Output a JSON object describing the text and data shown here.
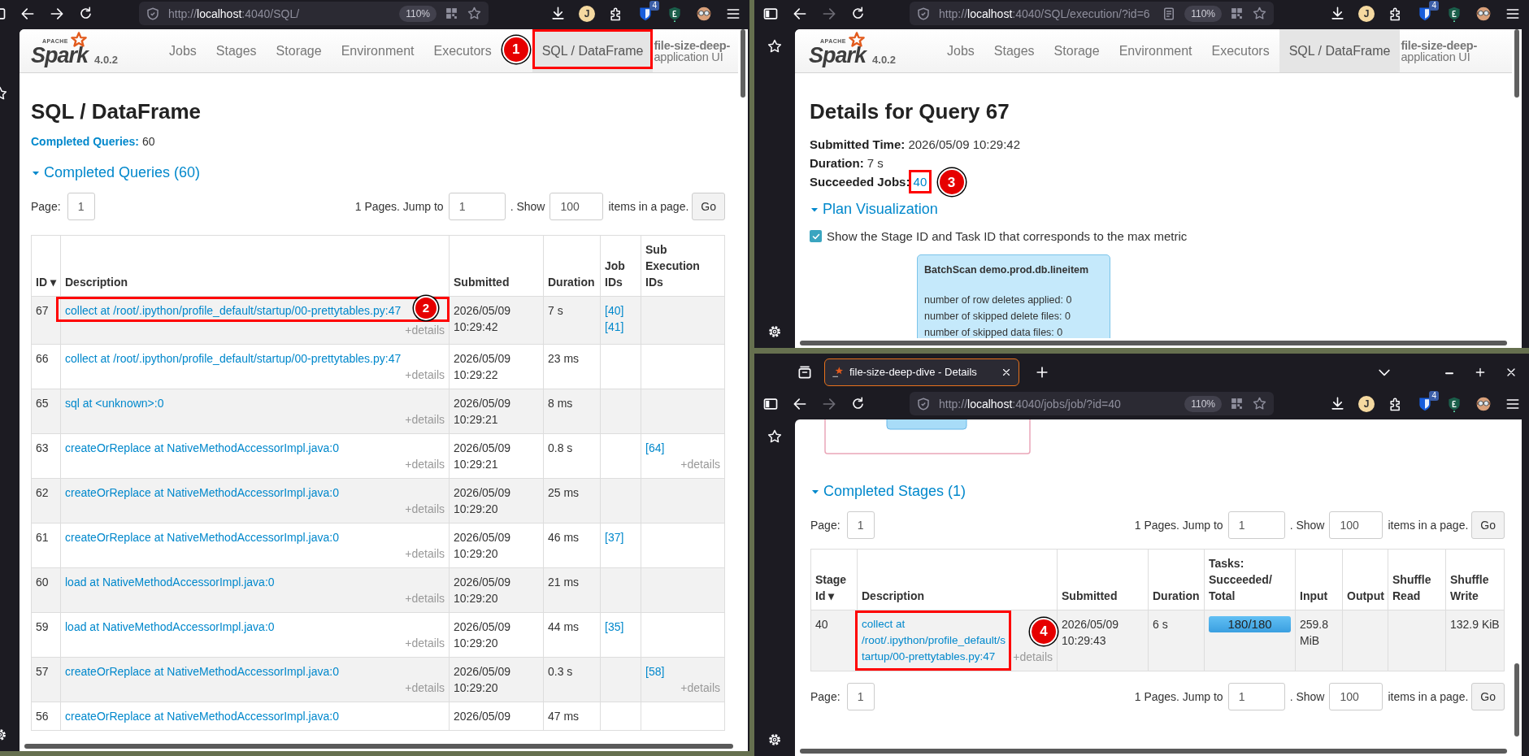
{
  "left_window": {
    "toolbar": {
      "url": {
        "scheme": "http://",
        "host": "localhost",
        "path": ":4040/SQL/"
      },
      "zoom": "110%",
      "profile_initial": "J",
      "extension_badge": "4",
      "forward_disabled": false
    },
    "navbar": {
      "logo_caption": "APACHE",
      "logo_word": "Spark",
      "version": "4.0.2",
      "tabs": [
        {
          "label": "Jobs",
          "selected": false
        },
        {
          "label": "Stages",
          "selected": false
        },
        {
          "label": "Storage",
          "selected": false
        },
        {
          "label": "Environment",
          "selected": false
        },
        {
          "label": "Executors",
          "selected": false
        },
        {
          "label": "SQL / DataFrame",
          "selected": true,
          "annotation": "1"
        }
      ],
      "app_name": [
        "file-size-deep-",
        "application UI"
      ]
    },
    "title": "SQL / DataFrame",
    "summary": "**Completed Queries:** 60",
    "section": {
      "title": "Completed Queries (60)",
      "expanded": true
    },
    "pager": {
      "page_label": "Page:",
      "page": "1",
      "pages_text": "1 Pages. Jump to",
      "jump": "1",
      "show_text": ". Show",
      "page_size": "100",
      "items_text": "items in a page.",
      "button": "Go"
    },
    "table": {
      "columns": [
        "ID ▾",
        "Description",
        "Submitted",
        "Duration",
        "Job IDs",
        "Sub Execution IDs"
      ],
      "rows": [
        {
          "id": "67",
          "description": "collect at /root/.ipython/profile_default/startup/00-prettytables.py:47",
          "details": "+details",
          "submitted": "2026/05/09 10:29:42",
          "duration": "7 s",
          "job_ids": [
            "[40]",
            "[41]"
          ],
          "annotation": "2"
        },
        {
          "id": "66",
          "description": "collect at /root/.ipython/profile_default/startup/00-prettytables.py:47",
          "details": "+details",
          "submitted": "2026/05/09 10:29:22",
          "duration": "23 ms"
        },
        {
          "id": "65",
          "description": "sql at <unknown>:0",
          "details": "+details",
          "submitted": "2026/05/09 10:29:21",
          "duration": "8 ms"
        },
        {
          "id": "63",
          "description": "createOrReplace at NativeMethodAccessorImpl.java:0",
          "details": "+details",
          "submitted": "2026/05/09 10:29:21",
          "duration": "0.8 s",
          "sub_ids": [
            "[64]"
          ],
          "sub_details": "+details"
        },
        {
          "id": "62",
          "description": "createOrReplace at NativeMethodAccessorImpl.java:0",
          "details": "+details",
          "submitted": "2026/05/09 10:29:20",
          "duration": "25 ms"
        },
        {
          "id": "61",
          "description": "createOrReplace at NativeMethodAccessorImpl.java:0",
          "details": "+details",
          "submitted": "2026/05/09 10:29:20",
          "duration": "46 ms",
          "job_ids": [
            "[37]"
          ]
        },
        {
          "id": "60",
          "description": "load at NativeMethodAccessorImpl.java:0",
          "details": "+details",
          "submitted": "2026/05/09 10:29:20",
          "duration": "21 ms"
        },
        {
          "id": "59",
          "description": "load at NativeMethodAccessorImpl.java:0",
          "details": "+details",
          "submitted": "2026/05/09 10:29:20",
          "duration": "44 ms",
          "job_ids": [
            "[35]"
          ]
        },
        {
          "id": "57",
          "description": "createOrReplace at NativeMethodAccessorImpl.java:0",
          "details": "+details",
          "submitted": "2026/05/09 10:29:20",
          "duration": "0.3 s",
          "sub_ids": [
            "[58]"
          ],
          "sub_details": "+details"
        },
        {
          "id": "56",
          "description": "createOrReplace at NativeMethodAccessorImpl.java:0",
          "submitted": "2026/05/09",
          "duration": "47 ms"
        }
      ]
    }
  },
  "top_right_window": {
    "toolbar": {
      "url": {
        "scheme": "http://",
        "host": "localhost",
        "path": ":4040/SQL/execution/?id=6"
      },
      "reader_mode_available": true,
      "zoom": "110%",
      "profile_initial": "J",
      "extension_badge": "4",
      "forward_disabled": true
    },
    "navbar": {
      "logo_caption": "APACHE",
      "logo_word": "Spark",
      "version": "4.0.2",
      "tabs": [
        {
          "label": "Jobs",
          "selected": false
        },
        {
          "label": "Stages",
          "selected": false
        },
        {
          "label": "Storage",
          "selected": false
        },
        {
          "label": "Environment",
          "selected": false
        },
        {
          "label": "Executors",
          "selected": false
        },
        {
          "label": "SQL / DataFrame",
          "selected": true
        }
      ],
      "app_name": [
        "file-size-deep-",
        "application UI"
      ]
    },
    "title": "Details for Query 67",
    "details": [
      {
        "text": "**Submitted Time:** 2026/05/09 10:29:42"
      },
      {
        "text": "**Duration:** 7 s"
      },
      {
        "text": "**Succeeded Jobs:**",
        "link": "40",
        "annotation": "3"
      }
    ],
    "plan": {
      "title": "Plan Visualization",
      "expanded": true
    },
    "max_metric": {
      "label": "Show the Stage ID and Task ID that corresponds to the max metric",
      "checked": true
    },
    "plan_node": {
      "title": "BatchScan demo.prod.db.lineitem",
      "metrics": [
        "number of row deletes applied: 0",
        "number of skipped delete files: 0",
        "number of skipped data files: 0"
      ]
    }
  },
  "bottom_right_window": {
    "tab": {
      "title": "file-size-deep-dive - Details"
    },
    "toolbar": {
      "url": {
        "scheme": "http://",
        "host": "localhost",
        "path": ":4040/jobs/job/?id=40"
      },
      "zoom": "110%",
      "profile_initial": "J",
      "extension_badge": "4",
      "forward_disabled": true
    },
    "section": {
      "title": "Completed Stages (1)",
      "expanded": true
    },
    "pager": {
      "page_label": "Page:",
      "page": "1",
      "pages_text": "1 Pages. Jump to",
      "jump": "1",
      "show_text": ". Show",
      "page_size": "100",
      "items_text": "items in a page.",
      "button": "Go"
    },
    "table": {
      "columns": [
        "Stage Id ▾",
        "Description",
        "Submitted",
        "Duration",
        "Tasks: Succeeded/ Total",
        "Input",
        "Output",
        "Shuffle Read",
        "Shuffle Write"
      ],
      "rows": [
        {
          "stage_id": "40",
          "description": "collect at /root/.ipython/profile_default/startup/00-prettytables.py:47",
          "details": "+details",
          "submitted": "2026/05/09 10:29:43",
          "duration": "6 s",
          "tasks": {
            "text": "180/180",
            "level": 1
          },
          "input": "259.8 MiB",
          "shuffle_write": "132.9 KiB",
          "annotation": "4"
        }
      ]
    },
    "pager_bottom": {
      "page_label": "Page:",
      "page": "1",
      "pages_text": "1 Pages. Jump to",
      "jump": "1",
      "show_text": ". Show",
      "page_size": "100",
      "items_text": "items in a page.",
      "button": "Go"
    }
  }
}
